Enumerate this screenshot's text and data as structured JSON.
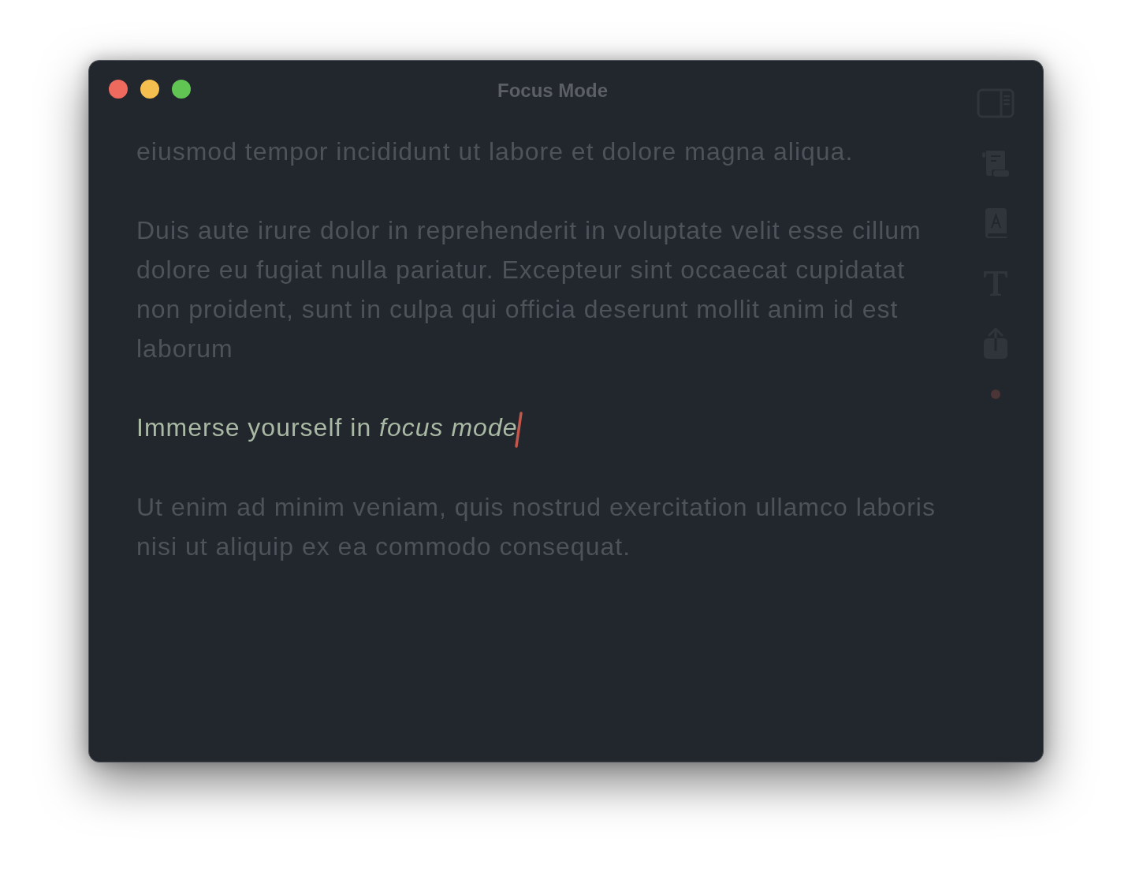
{
  "window": {
    "title": "Focus Mode"
  },
  "paragraphs": [
    {
      "text": "eiusmod tempor incididunt ut labore et dolore magna aliqua.",
      "focused": false
    },
    {
      "text": "Duis aute irure dolor in reprehenderit in voluptate velit esse cillum dolore eu fugiat nulla pariatur. Excepteur sint occaecat cupidatat non proident, sunt in culpa qui officia deserunt mollit anim id est laborum",
      "focused": false
    },
    {
      "text": "Immerse yourself in *focus mode*",
      "focused": true
    },
    {
      "text": "Ut enim ad minim veniam, quis nostrud exercitation ullamco laboris nisi ut aliquip ex ea commodo consequat.",
      "focused": false
    }
  ]
}
